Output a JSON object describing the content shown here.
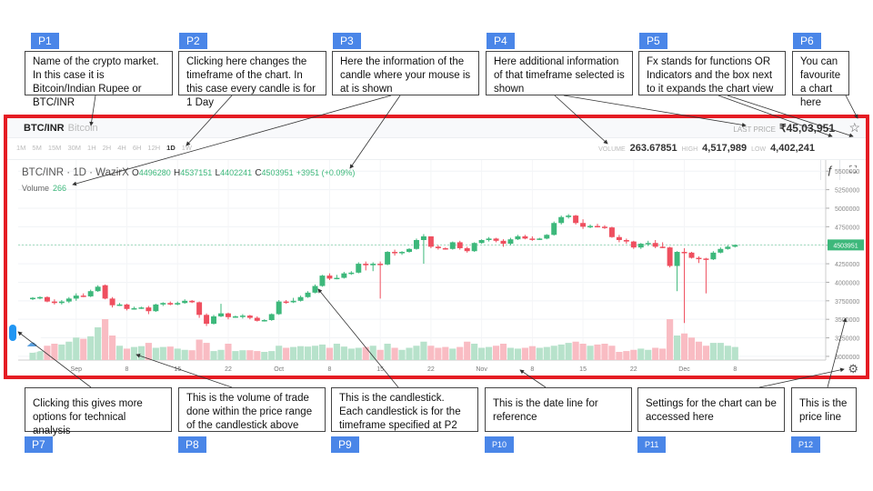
{
  "annotations_top": [
    {
      "tag": "P1",
      "text": "Name of the crypto market. In this case it is Bitcoin/Indian Rupee or BTC/INR"
    },
    {
      "tag": "P2",
      "text": "Clicking here changes the timeframe of the chart. In this case every candle is for 1 Day"
    },
    {
      "tag": "P3",
      "text": "Here the information of the candle where your mouse is at is shown"
    },
    {
      "tag": "P4",
      "text": "Here additional information of that timeframe selected is shown"
    },
    {
      "tag": "P5",
      "text": "Fx stands for functions OR Indicators and the box next to it expands the chart view"
    },
    {
      "tag": "P6",
      "text": "You can favourite a chart here"
    }
  ],
  "annotations_bottom": [
    {
      "tag": "P7",
      "text": "Clicking this gives more options for technical analysis"
    },
    {
      "tag": "P8",
      "text": "This is the volume of trade done within the price range of the candlestick above"
    },
    {
      "tag": "P9",
      "text": "This is the candlestick. Each candlestick is for the timeframe specified at P2"
    },
    {
      "tag": "P10",
      "text": "This is the date line for reference"
    },
    {
      "tag": "P11",
      "text": "Settings for the chart can be accessed here"
    },
    {
      "tag": "P12",
      "text": "This is the price line"
    }
  ],
  "header": {
    "pair": "BTC/INR",
    "pair_name": "Bitcoin",
    "last_price_label": "LAST PRICE",
    "last_price": "₹45,03,951",
    "star_icon": "star-icon"
  },
  "timeframes": [
    "1M",
    "5M",
    "15M",
    "30M",
    "1H",
    "2H",
    "4H",
    "6H",
    "12H",
    "1D",
    "1W"
  ],
  "active_timeframe": "1D",
  "stats": {
    "volume_label": "VOLUME",
    "volume": "263.67851",
    "high_label": "HIGH",
    "high": "4,517,989",
    "low_label": "LOW",
    "low": "4,402,241",
    "fx_label": "ƒ",
    "expand_icon": "⛶"
  },
  "legend": {
    "title": "BTC/INR · 1D · WazirX",
    "o_label": "O",
    "o": "4496280",
    "h_label": "H",
    "h": "4537151",
    "l_label": "L",
    "l": "4402241",
    "c_label": "C",
    "c": "4503951",
    "change": "+3951 (+0.09%)",
    "volume_label": "Volume",
    "volume": "266"
  },
  "colors": {
    "up": "#3db87b",
    "down": "#ef4f5f",
    "vol_up": "#b7e2cb",
    "vol_down": "#f9bcc3",
    "frame": "#e51c23",
    "tag": "#4a86e8",
    "price_tag": "#3db87b"
  },
  "chart_data": {
    "type": "candlestick",
    "title": "BTC/INR · 1D · WazirX",
    "ylim": [
      2950000,
      5650000
    ],
    "y_ticks": [
      3000000,
      3250000,
      3500000,
      3750000,
      4000000,
      4250000,
      4500000,
      4750000,
      5000000,
      5250000,
      5500000
    ],
    "x_ticks": [
      "Sep",
      "8",
      "15",
      "22",
      "Oct",
      "8",
      "15",
      "22",
      "Nov",
      "8",
      "15",
      "22",
      "Dec",
      "8"
    ],
    "last_price_tag": "4503951",
    "last_price": 4503951,
    "candles": [
      [
        3780000,
        3800000,
        3760000,
        3790000,
        0.25
      ],
      [
        3790000,
        3810000,
        3770000,
        3800000,
        0.22
      ],
      [
        3800000,
        3810000,
        3730000,
        3740000,
        0.35
      ],
      [
        3740000,
        3770000,
        3700000,
        3720000,
        0.4
      ],
      [
        3720000,
        3760000,
        3700000,
        3740000,
        0.38
      ],
      [
        3740000,
        3800000,
        3720000,
        3780000,
        0.45
      ],
      [
        3780000,
        3850000,
        3750000,
        3820000,
        0.55
      ],
      [
        3820000,
        3850000,
        3800000,
        3810000,
        0.52
      ],
      [
        3810000,
        3900000,
        3800000,
        3880000,
        0.58
      ],
      [
        3880000,
        3960000,
        3870000,
        3940000,
        0.8
      ],
      [
        3960000,
        3970000,
        3770000,
        3780000,
        1.0
      ],
      [
        3780000,
        3800000,
        3660000,
        3690000,
        0.6
      ],
      [
        3690000,
        3720000,
        3680000,
        3700000,
        0.35
      ],
      [
        3700000,
        3710000,
        3620000,
        3640000,
        0.28
      ],
      [
        3640000,
        3670000,
        3630000,
        3650000,
        0.32
      ],
      [
        3650000,
        3670000,
        3640000,
        3660000,
        0.34
      ],
      [
        3660000,
        3680000,
        3570000,
        3610000,
        0.42
      ],
      [
        3610000,
        3710000,
        3600000,
        3700000,
        0.3
      ],
      [
        3700000,
        3730000,
        3680000,
        3720000,
        0.32
      ],
      [
        3720000,
        3740000,
        3690000,
        3700000,
        0.33
      ],
      [
        3700000,
        3740000,
        3690000,
        3720000,
        0.28
      ],
      [
        3720000,
        3770000,
        3710000,
        3750000,
        0.25
      ],
      [
        3750000,
        3760000,
        3720000,
        3730000,
        0.24
      ],
      [
        3730000,
        3740000,
        3520000,
        3560000,
        0.5
      ],
      [
        3560000,
        3580000,
        3410000,
        3440000,
        0.42
      ],
      [
        3440000,
        3560000,
        3430000,
        3540000,
        0.22
      ],
      [
        3540000,
        3710000,
        3530000,
        3580000,
        0.25
      ],
      [
        3580000,
        3590000,
        3500000,
        3530000,
        0.4
      ],
      [
        3530000,
        3550000,
        3520000,
        3540000,
        0.22
      ],
      [
        3540000,
        3570000,
        3510000,
        3550000,
        0.24
      ],
      [
        3550000,
        3560000,
        3500000,
        3520000,
        0.24
      ],
      [
        3520000,
        3540000,
        3470000,
        3480000,
        0.22
      ],
      [
        3480000,
        3500000,
        3470000,
        3490000,
        0.2
      ],
      [
        3490000,
        3580000,
        3480000,
        3570000,
        0.22
      ],
      [
        3570000,
        3760000,
        3560000,
        3740000,
        0.35
      ],
      [
        3740000,
        3760000,
        3710000,
        3730000,
        0.3
      ],
      [
        3730000,
        3790000,
        3720000,
        3750000,
        0.32
      ],
      [
        3750000,
        3820000,
        3740000,
        3800000,
        0.34
      ],
      [
        3800000,
        3880000,
        3790000,
        3860000,
        0.33
      ],
      [
        3860000,
        3970000,
        3850000,
        3950000,
        0.35
      ],
      [
        3950000,
        4100000,
        3940000,
        4090000,
        0.38
      ],
      [
        4090000,
        4120000,
        4030000,
        4050000,
        0.3
      ],
      [
        4050000,
        4100000,
        4040000,
        4060000,
        0.4
      ],
      [
        4060000,
        4140000,
        4050000,
        4120000,
        0.33
      ],
      [
        4120000,
        4150000,
        4100000,
        4130000,
        0.28
      ],
      [
        4130000,
        4270000,
        4120000,
        4250000,
        0.3
      ],
      [
        4250000,
        4280000,
        4160000,
        4230000,
        0.32
      ],
      [
        4230000,
        4270000,
        4150000,
        4250000,
        0.35
      ],
      [
        4250000,
        4280000,
        3780000,
        4240000,
        0.25
      ],
      [
        4240000,
        4420000,
        4230000,
        4410000,
        0.4
      ],
      [
        4410000,
        4440000,
        4360000,
        4400000,
        0.3
      ],
      [
        4400000,
        4420000,
        4370000,
        4410000,
        0.25
      ],
      [
        4410000,
        4460000,
        4400000,
        4450000,
        0.3
      ],
      [
        4450000,
        4590000,
        4440000,
        4570000,
        0.35
      ],
      [
        4570000,
        4650000,
        4250000,
        4620000,
        0.45
      ],
      [
        4620000,
        4620000,
        4460000,
        4480000,
        0.35
      ],
      [
        4480000,
        4500000,
        4440000,
        4460000,
        0.3
      ],
      [
        4460000,
        4470000,
        4440000,
        4450000,
        0.32
      ],
      [
        4450000,
        4550000,
        4440000,
        4540000,
        0.28
      ],
      [
        4540000,
        4560000,
        4440000,
        4460000,
        0.32
      ],
      [
        4460000,
        4480000,
        4400000,
        4420000,
        0.45
      ],
      [
        4420000,
        4540000,
        4410000,
        4530000,
        0.4
      ],
      [
        4530000,
        4580000,
        4520000,
        4570000,
        0.3
      ],
      [
        4570000,
        4610000,
        4550000,
        4590000,
        0.32
      ],
      [
        4590000,
        4600000,
        4540000,
        4560000,
        0.35
      ],
      [
        4560000,
        4580000,
        4480000,
        4520000,
        0.4
      ],
      [
        4520000,
        4600000,
        4500000,
        4580000,
        0.3
      ],
      [
        4580000,
        4640000,
        4570000,
        4620000,
        0.28
      ],
      [
        4620000,
        4640000,
        4580000,
        4590000,
        0.3
      ],
      [
        4590000,
        4620000,
        4560000,
        4580000,
        0.34
      ],
      [
        4580000,
        4600000,
        4570000,
        4590000,
        0.3
      ],
      [
        4590000,
        4650000,
        4580000,
        4640000,
        0.32
      ],
      [
        4640000,
        4820000,
        4630000,
        4800000,
        0.35
      ],
      [
        4800000,
        4900000,
        4780000,
        4880000,
        0.38
      ],
      [
        4880000,
        4920000,
        4860000,
        4900000,
        0.42
      ],
      [
        4900000,
        4910000,
        4780000,
        4800000,
        0.45
      ],
      [
        4800000,
        4850000,
        4720000,
        4750000,
        0.4
      ],
      [
        4750000,
        4780000,
        4730000,
        4760000,
        0.35
      ],
      [
        4760000,
        4790000,
        4740000,
        4750000,
        0.38
      ],
      [
        4750000,
        4770000,
        4720000,
        4740000,
        0.4
      ],
      [
        4740000,
        4750000,
        4600000,
        4610000,
        0.35
      ],
      [
        4610000,
        4640000,
        4540000,
        4570000,
        0.2
      ],
      [
        4570000,
        4590000,
        4520000,
        4550000,
        0.22
      ],
      [
        4550000,
        4560000,
        4450000,
        4470000,
        0.25
      ],
      [
        4470000,
        4530000,
        4450000,
        4520000,
        0.28
      ],
      [
        4520000,
        4560000,
        4490000,
        4530000,
        0.25
      ],
      [
        4530000,
        4570000,
        4460000,
        4480000,
        0.3
      ],
      [
        4480000,
        4540000,
        4460000,
        4470000,
        0.28
      ],
      [
        4470000,
        4480000,
        4200000,
        4220000,
        1.0
      ],
      [
        4220000,
        4420000,
        3880000,
        4410000,
        0.6
      ],
      [
        4410000,
        4460000,
        3450000,
        4400000,
        0.65
      ],
      [
        4400000,
        4410000,
        4320000,
        4330000,
        0.55
      ],
      [
        4330000,
        4350000,
        4260000,
        4320000,
        0.45
      ],
      [
        4320000,
        4330000,
        3850000,
        4310000,
        0.35
      ],
      [
        4310000,
        4420000,
        4300000,
        4400000,
        0.42
      ],
      [
        4400000,
        4470000,
        4390000,
        4450000,
        0.42
      ],
      [
        4450000,
        4500000,
        4440000,
        4480000,
        0.35
      ],
      [
        4480000,
        4510000,
        4470000,
        4503951,
        0.32
      ]
    ]
  }
}
